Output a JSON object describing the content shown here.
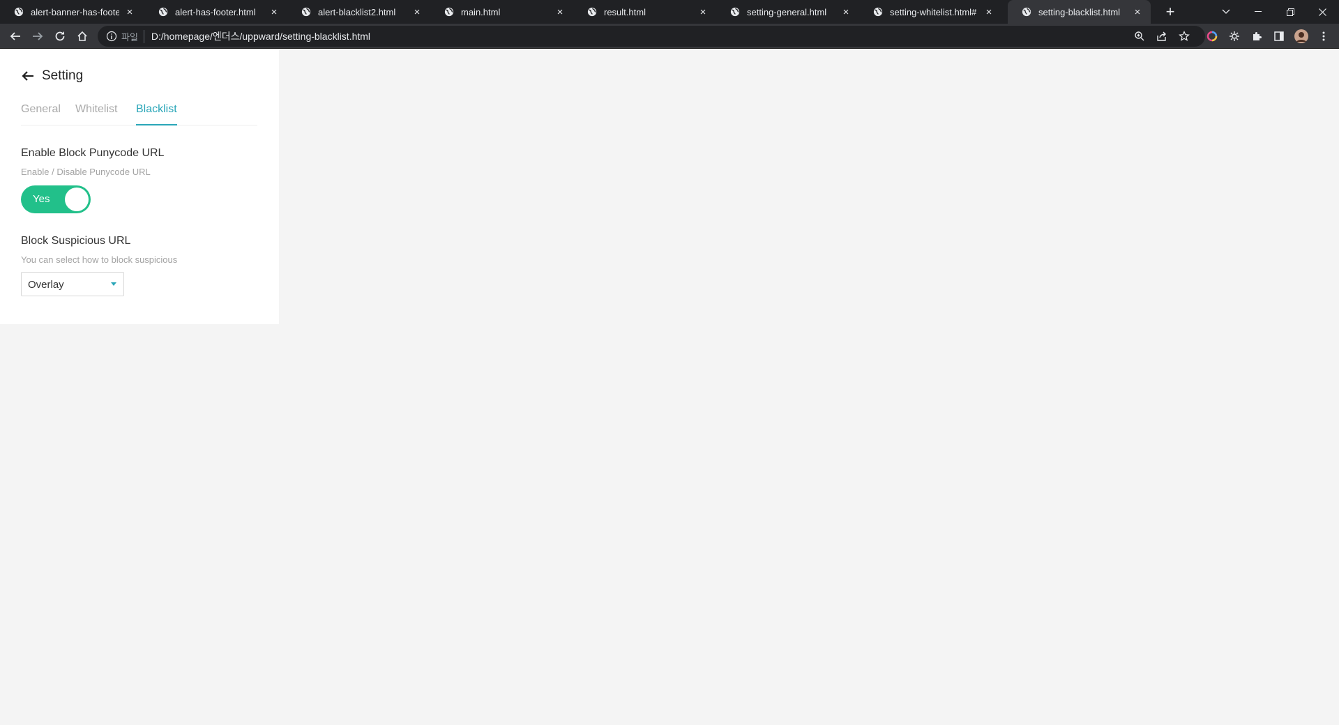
{
  "browser": {
    "tabs": [
      {
        "title": "alert-banner-has-footer.html",
        "active": false
      },
      {
        "title": "alert-has-footer.html",
        "active": false
      },
      {
        "title": "alert-blacklist2.html",
        "active": false
      },
      {
        "title": "main.html",
        "active": false
      },
      {
        "title": "result.html",
        "active": false
      },
      {
        "title": "setting-general.html",
        "active": false
      },
      {
        "title": "setting-whitelist.html#",
        "active": false
      },
      {
        "title": "setting-blacklist.html",
        "active": true
      }
    ],
    "new_tab_glyph": "+",
    "close_glyph": "×",
    "address": {
      "scheme_label": "파일",
      "url": "D:/homepage/엔더스/uppward/setting-blacklist.html"
    },
    "icons": [
      "back-icon",
      "forward-icon",
      "reload-icon",
      "home-icon",
      "info-icon",
      "zoom-icon",
      "share-icon",
      "star-icon",
      "extension-color-icon",
      "extension-gear-icon",
      "puzzle-icon",
      "sidepanel-icon",
      "profile-avatar",
      "menu-icon"
    ]
  },
  "page": {
    "title": "Setting",
    "tabs": [
      {
        "label": "General",
        "active": false
      },
      {
        "label": "Whitelist",
        "active": false
      },
      {
        "label": "Blacklist",
        "active": true
      }
    ],
    "punycode": {
      "title": "Enable Block Punycode URL",
      "description": "Enable / Disable Punycode URL",
      "toggle_label": "Yes",
      "enabled": true
    },
    "suspicious": {
      "title": "Block Suspicious URL",
      "description": "You can select how to block suspicious",
      "selected": "Overlay"
    }
  },
  "colors": {
    "accent": "#2aa6b8",
    "toggle_on": "#22c08a",
    "page_bg": "#f4f4f4",
    "chrome_dark": "#202124",
    "chrome_toolbar": "#35363a"
  }
}
